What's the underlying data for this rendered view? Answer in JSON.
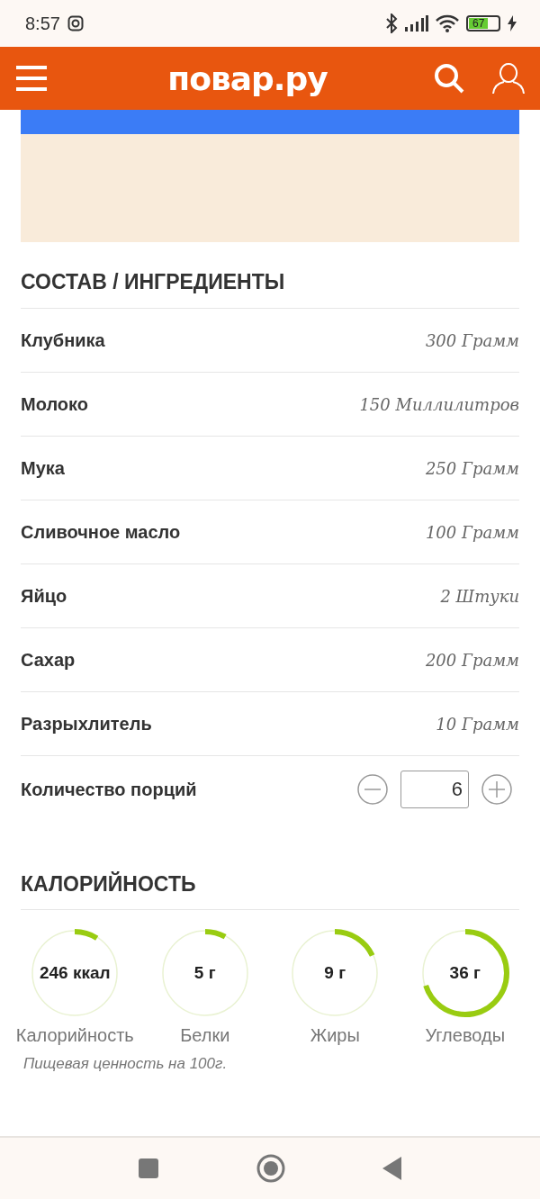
{
  "status_bar": {
    "time": "8:57",
    "battery": "67"
  },
  "header": {
    "logo": "повар.ру"
  },
  "ingredients": {
    "title": "СОСТАВ / ИНГРЕДИЕНТЫ",
    "items": [
      {
        "name": "Клубника",
        "amount": "300 Грамм"
      },
      {
        "name": "Молоко",
        "amount": "150 Миллилитров"
      },
      {
        "name": "Мука",
        "amount": "250 Грамм"
      },
      {
        "name": "Сливочное масло",
        "amount": "100 Грамм"
      },
      {
        "name": "Яйцо",
        "amount": "2 Штуки"
      },
      {
        "name": "Сахар",
        "amount": "200 Грамм"
      },
      {
        "name": "Разрыхлитель",
        "amount": "10 Грамм"
      }
    ],
    "servings": {
      "label": "Количество порций",
      "value": "6"
    }
  },
  "nutrition": {
    "title": "КАЛОРИЙНОСТЬ",
    "items": [
      {
        "value": "246 ккал",
        "label": "Калорийность",
        "level": 0.09
      },
      {
        "value": "5 г",
        "label": "Белки",
        "level": 0.08
      },
      {
        "value": "9 г",
        "label": "Жиры",
        "level": 0.18
      },
      {
        "value": "36 г",
        "label": "Углеводы",
        "level": 0.7
      }
    ],
    "note": "Пищевая ценность на 100г."
  }
}
